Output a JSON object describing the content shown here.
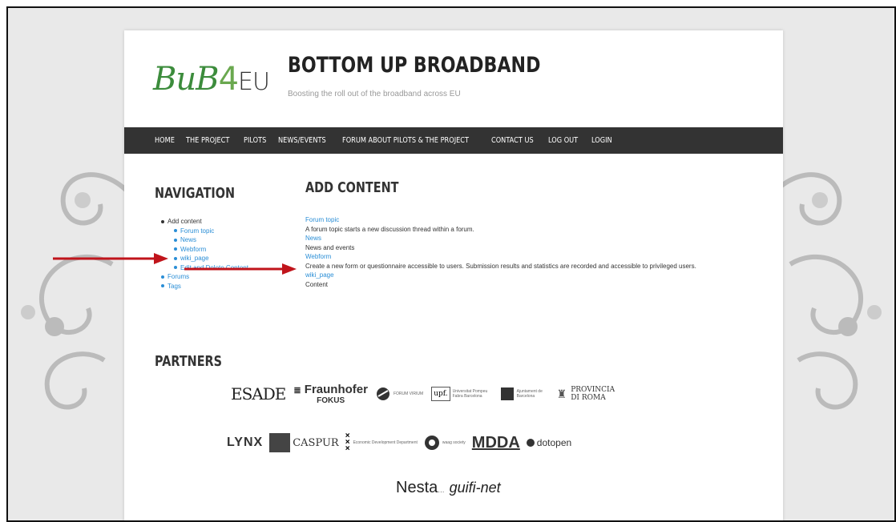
{
  "header": {
    "logo": {
      "bub": "BuB",
      "num": "4",
      "eu": "EU"
    },
    "site_title": "BOTTOM UP BROADBAND",
    "site_slogan": "Boosting the roll out of the broadband across EU"
  },
  "navbar": {
    "items": [
      "HOME",
      "THE PROJECT",
      "PILOTS",
      "NEWS/EVENTS",
      "FORUM ABOUT PILOTS & THE PROJECT",
      "CONTACT US",
      "LOG OUT",
      "LOGIN"
    ]
  },
  "sidebar": {
    "heading": "NAVIGATION",
    "add_content": "Add content",
    "sub_items": [
      "Forum topic",
      "News",
      "Webform",
      "wiki_page",
      "Edit and Delete Content"
    ],
    "forums": "Forums",
    "tags": "Tags"
  },
  "main": {
    "heading": "ADD CONTENT",
    "items": [
      {
        "link": "Forum topic",
        "desc": "A forum topic starts a new discussion thread within a forum."
      },
      {
        "link": "News",
        "desc": "News and events"
      },
      {
        "link": "Webform",
        "desc": "Create a new form or questionnaire accessible to users. Submission results and statistics are recorded and accessible to privileged users."
      },
      {
        "link": "wiki_page",
        "desc": "Content"
      }
    ]
  },
  "partners": {
    "heading": "PARTNERS",
    "esade": {
      "a": "ESADE",
      "b": ""
    },
    "fraunhofer": "Fraunhofer",
    "fokus": "FOKUS",
    "forum_virium": "FORUM VIRIUM",
    "upf": "upf.",
    "upf_text": "Universitat Pompeu Fabra Barcelona",
    "ajuntament": "Ajuntament de Barcelona",
    "provincia": "PROVINCIA",
    "di_roma": "DI ROMA",
    "lynx": "LYNX",
    "caspur": "CASPUR",
    "amsterdam": "Economic Development Department",
    "waag": "waag society",
    "mdda": "MDDA",
    "dotopen": "dotopen",
    "nesta": "Nesta",
    "guifi": "guifi-net"
  },
  "colors": {
    "arrow": "#c0141b",
    "link": "#2a8ed6",
    "navbar": "#333333"
  }
}
